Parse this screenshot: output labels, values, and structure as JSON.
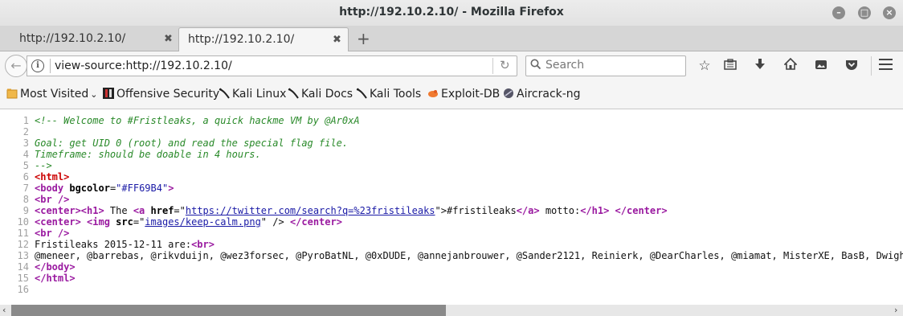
{
  "window": {
    "title": "http://192.10.2.10/ - Mozilla Firefox"
  },
  "tabs": [
    {
      "label": "http://192.10.2.10/",
      "active": false
    },
    {
      "label": "http://192.10.2.10/",
      "active": true
    }
  ],
  "nav": {
    "url": "view-source:http://192.10.2.10/",
    "search_placeholder": "Search"
  },
  "bookmarks": [
    {
      "label": "Most Visited",
      "icon": "folder-icon"
    },
    {
      "label": "Offensive Security",
      "icon": "offsec-icon"
    },
    {
      "label": "Kali Linux",
      "icon": "kali-dragon-icon"
    },
    {
      "label": "Kali Docs",
      "icon": "kali-dragon-icon"
    },
    {
      "label": "Kali Tools",
      "icon": "kali-dragon-icon"
    },
    {
      "label": "Exploit-DB",
      "icon": "exploit-db-icon"
    },
    {
      "label": "Aircrack-ng",
      "icon": "aircrack-icon"
    }
  ],
  "source": {
    "line_numbers": [
      "1",
      "2",
      "3",
      "4",
      "5",
      "6",
      "7",
      "8",
      "9",
      "10",
      "11",
      "12",
      "13",
      "14",
      "15",
      "16"
    ],
    "l1": "<!-- Welcome to #Fristleaks, a quick hackme VM by @Ar0xA",
    "l3": "Goal: get UID 0 (root) and read the special flag file.",
    "l4": "Timeframe: should be doable in 4 hours.",
    "l5": "-->",
    "l6": "<html>",
    "l7_tag": "<body ",
    "l7_attr": "bgcolor",
    "l7_val": "\"#FF69B4\"",
    "l7_end": ">",
    "l8": "<br />",
    "l9_a": "<center>",
    "l9_b": "<h1>",
    "l9_c": " The ",
    "l9_d": "<a ",
    "l9_e": "href",
    "l9_f": "=\"",
    "l9_link": "https://twitter.com/search?q=%23fristileaks",
    "l9_g": "\">",
    "l9_h": "#fristileaks",
    "l9_i": "</a>",
    "l9_j": " motto:",
    "l9_k": "</h1>",
    "l9_l": " ",
    "l9_m": "</center>",
    "l10_a": "<center>",
    "l10_b": " ",
    "l10_c": "<img ",
    "l10_d": "src",
    "l10_e": "=\"",
    "l10_link": "images/keep-calm.png",
    "l10_f": "\" />",
    "l10_g": " ",
    "l10_h": "</center>",
    "l11": "<br />",
    "l12_a": "Fristileaks 2015-12-11 are:",
    "l12_b": "<br>",
    "l13": "@meneer, @barrebas, @rikvduijn, @wez3forsec, @PyroBatNL, @0xDUDE, @annejanbrouwer, @Sander2121, Reinierk, @DearCharles, @miamat, MisterXE, BasB, Dwight, Eg",
    "l14": "</body>",
    "l15": "</html>"
  }
}
